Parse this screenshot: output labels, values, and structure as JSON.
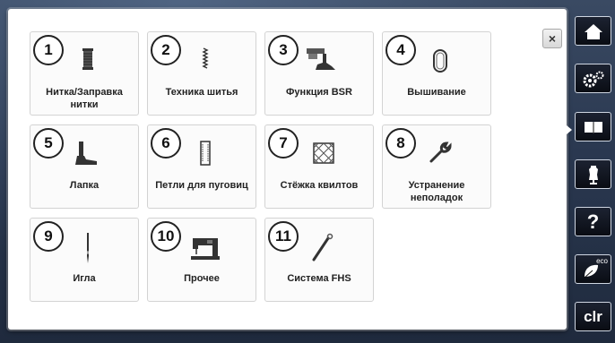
{
  "dialog": {
    "close_label": "×",
    "tiles": [
      {
        "number": "1",
        "label": "Нитка/Заправка нитки"
      },
      {
        "number": "2",
        "label": "Техника шитья"
      },
      {
        "number": "3",
        "label": "Функция BSR"
      },
      {
        "number": "4",
        "label": "Вышивание"
      },
      {
        "number": "5",
        "label": "Лапка"
      },
      {
        "number": "6",
        "label": "Петли для пуговиц"
      },
      {
        "number": "7",
        "label": "Стёжка квилтов"
      },
      {
        "number": "8",
        "label": "Устранение неполадок"
      },
      {
        "number": "9",
        "label": "Игла"
      },
      {
        "number": "10",
        "label": "Прочее"
      },
      {
        "number": "11",
        "label": "Система  FHS"
      }
    ]
  },
  "sidebar": {
    "buttons": [
      {
        "icon": "home-icon"
      },
      {
        "icon": "settings-icon"
      },
      {
        "icon": "book-icon"
      },
      {
        "icon": "dress-form-icon"
      },
      {
        "icon": "help-icon",
        "text": "?"
      },
      {
        "icon": "eco-leaf-icon",
        "text": "eco"
      },
      {
        "icon": "clear-icon",
        "text": "clr"
      }
    ]
  },
  "colors": {
    "background": "#2a3850",
    "panel": "#ffffff",
    "tile_border": "#d3d3d3",
    "sidebar_button": "#0a0d14",
    "sidebar_border": "#cfd6e2"
  }
}
